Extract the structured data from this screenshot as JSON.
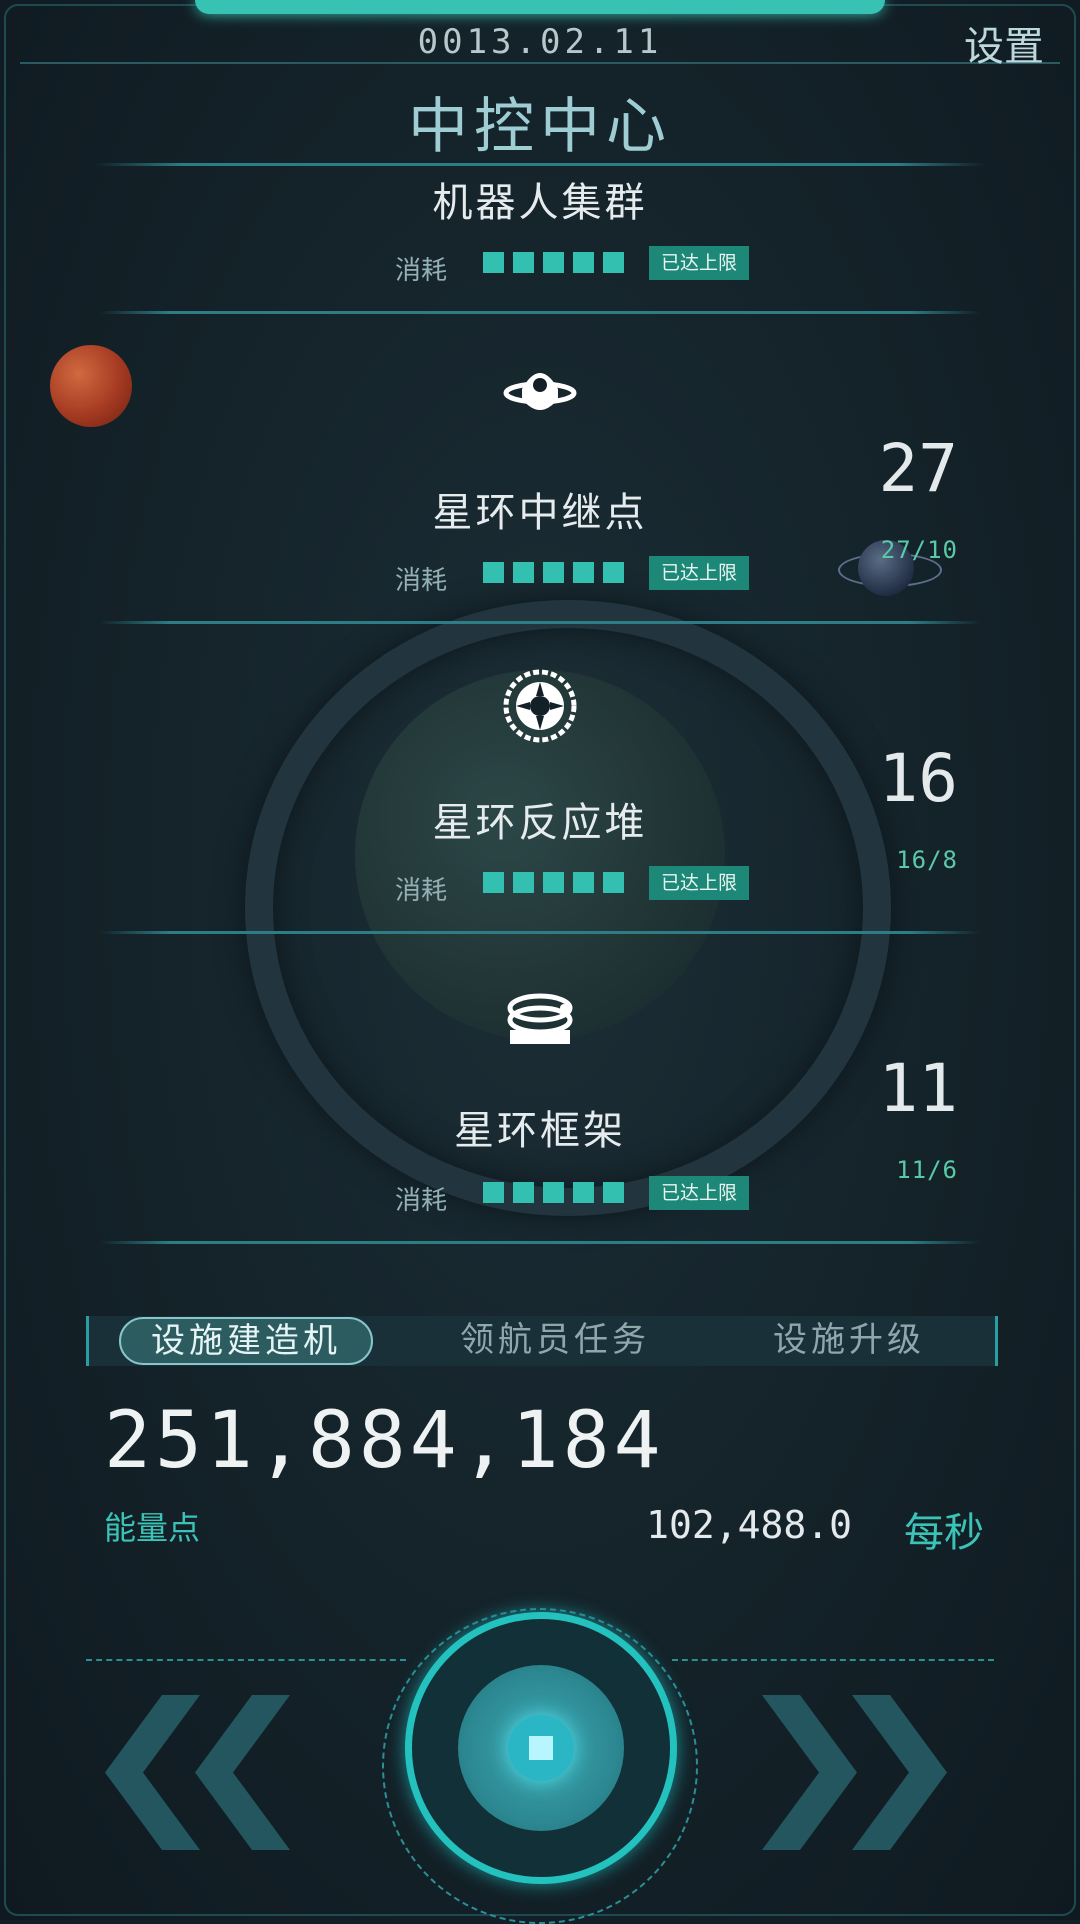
{
  "header": {
    "date": "0013.02.11",
    "settings_label": "设置",
    "title": "中控中心"
  },
  "rows": [
    {
      "name": "机器人集群",
      "count": "",
      "ratio": "",
      "cost_label": "消耗",
      "cost_level": 5,
      "badge": "已达上限",
      "icon": "robot-cluster-icon"
    },
    {
      "name": "星环中继点",
      "count": "27",
      "ratio": "27/10",
      "cost_label": "消耗",
      "cost_level": 5,
      "badge": "已达上限",
      "icon": "relay-station-icon"
    },
    {
      "name": "星环反应堆",
      "count": "16",
      "ratio": "16/8",
      "cost_label": "消耗",
      "cost_level": 5,
      "badge": "已达上限",
      "icon": "reactor-icon"
    },
    {
      "name": "星环框架",
      "count": "11",
      "ratio": "11/6",
      "cost_label": "消耗",
      "cost_level": 5,
      "badge": "已达上限",
      "icon": "ring-frame-icon"
    }
  ],
  "tabs": [
    "设施建造机",
    "领航员任务",
    "设施升级"
  ],
  "active_tab": "设施建造机",
  "energy": {
    "amount": "251,884,184",
    "label": "能量点",
    "rate": "102,488.0",
    "rate_unit": "每秒"
  },
  "colors": {
    "accent": "#33c0b1",
    "badge": "#1e8878",
    "ratio": "#59c9a8",
    "background": "#132027"
  }
}
